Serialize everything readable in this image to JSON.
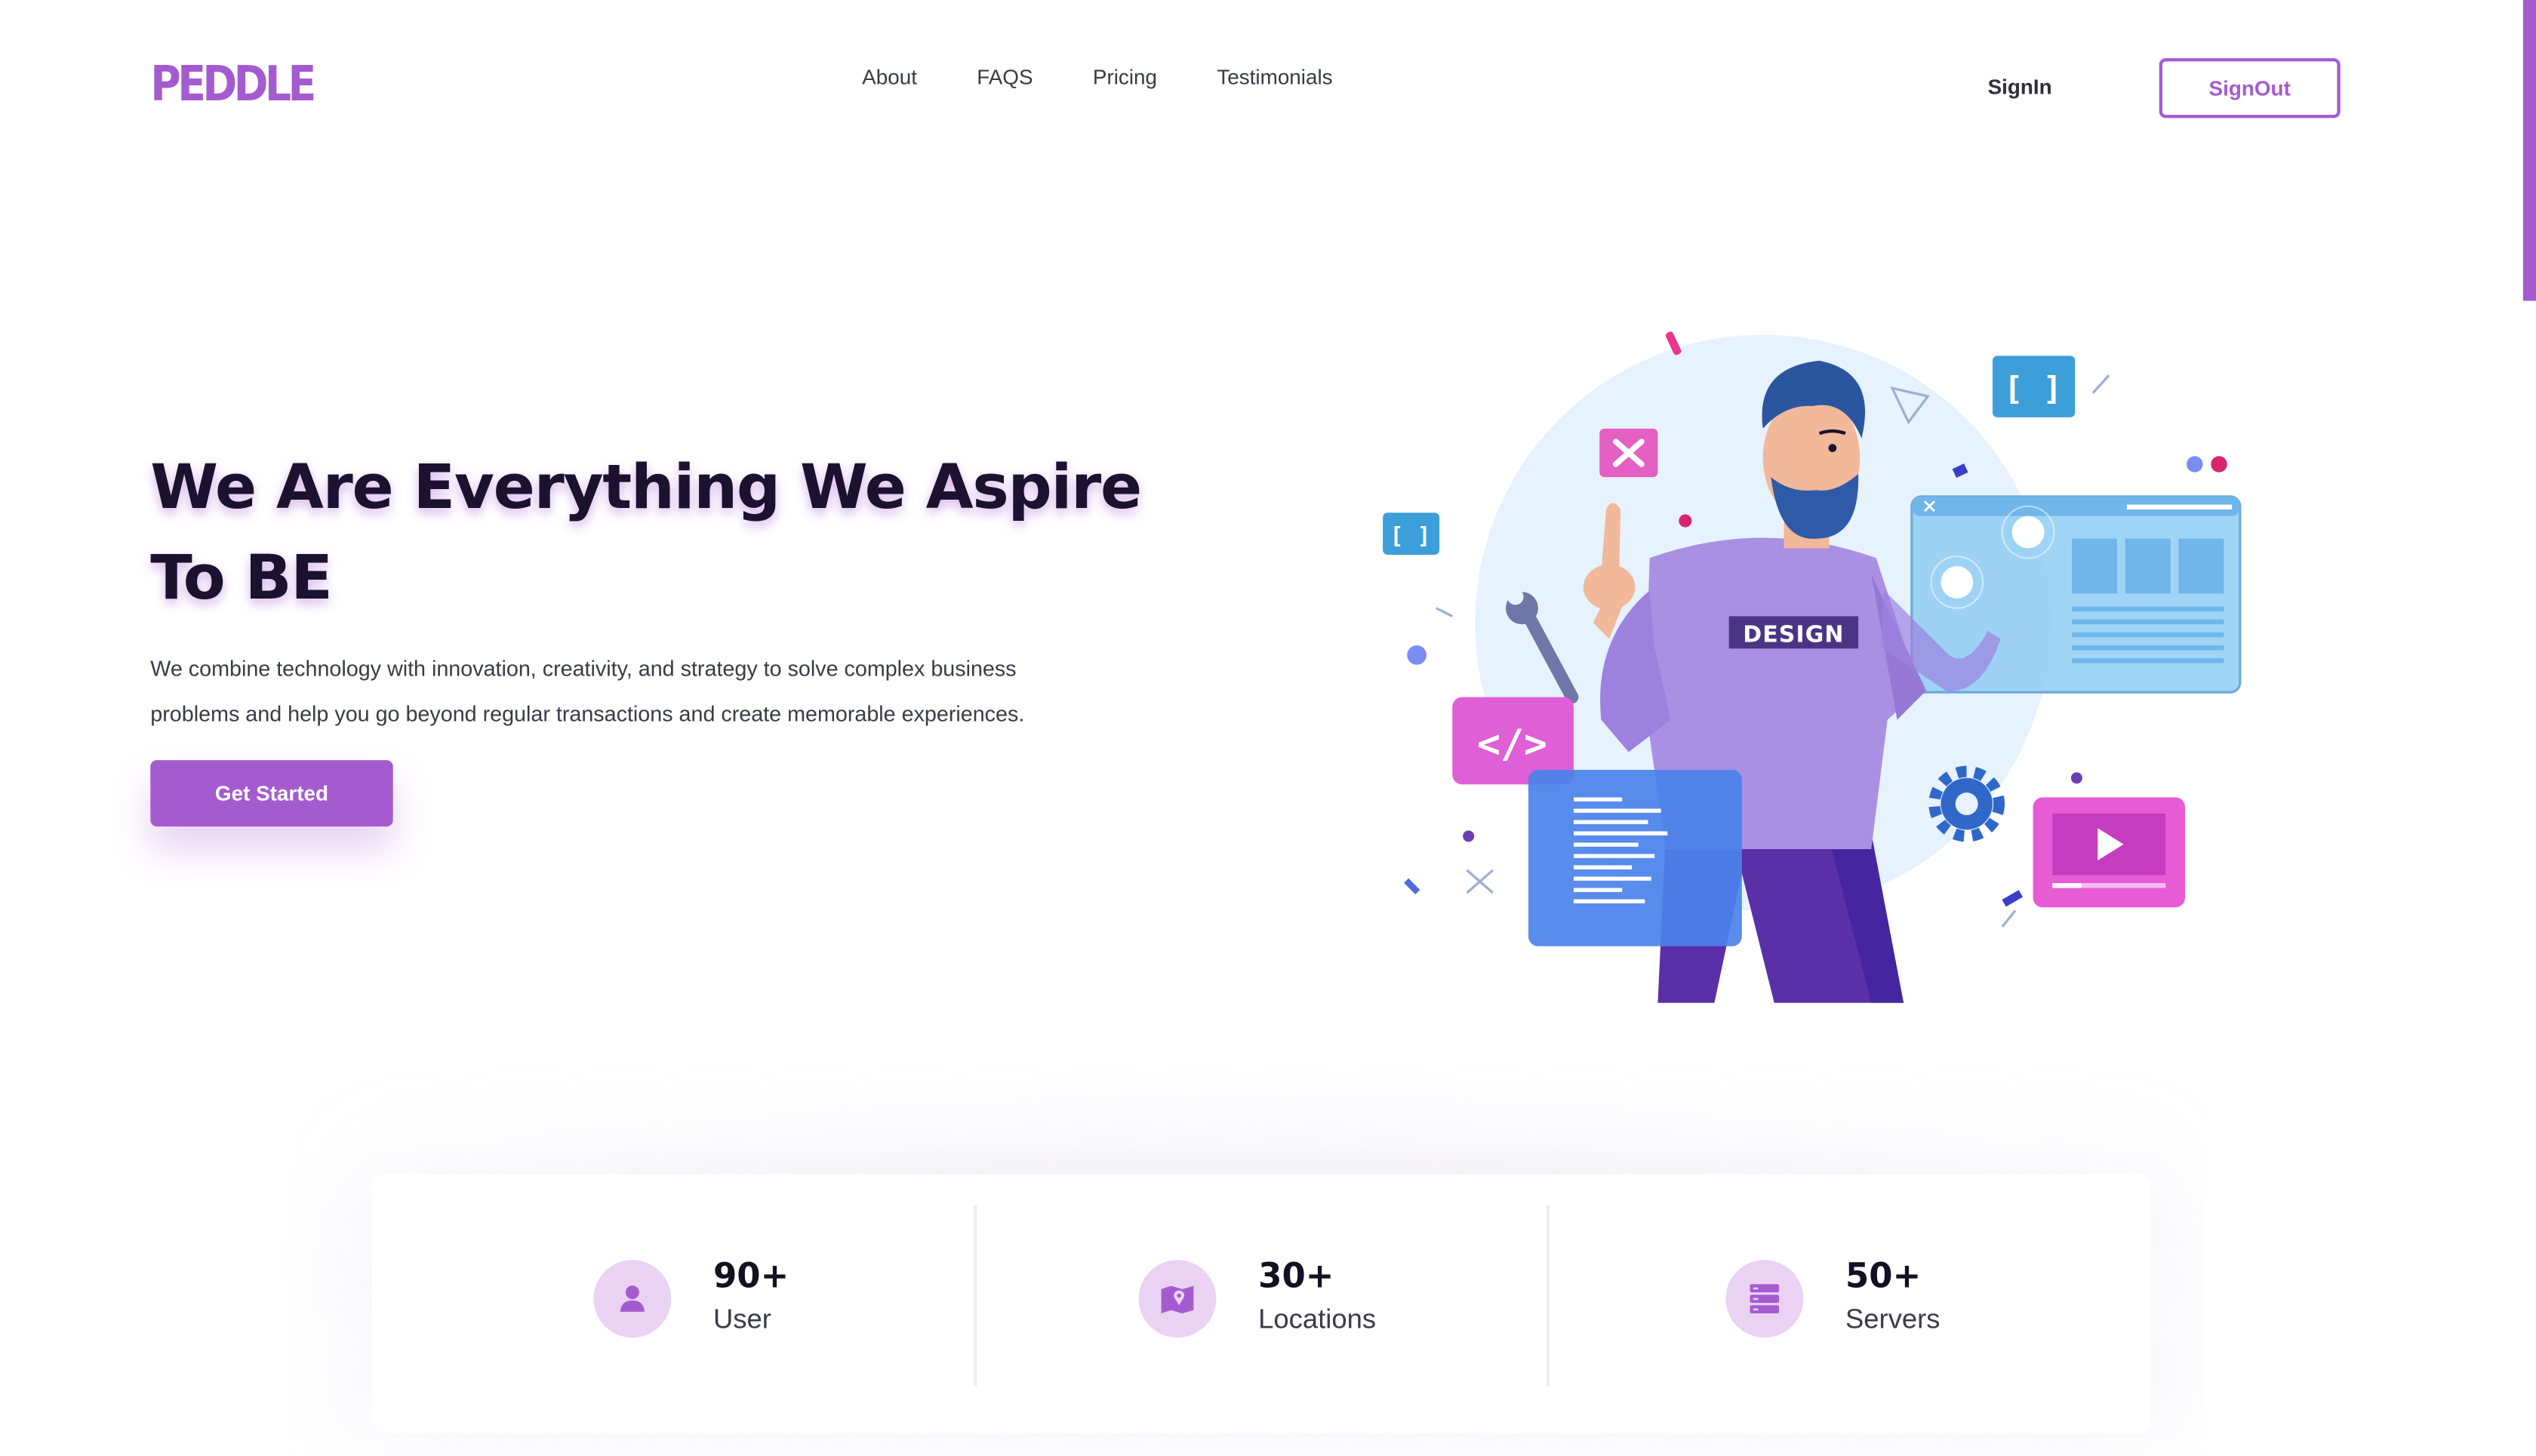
{
  "brand": {
    "logo_text": "PEDDLE",
    "accent_color": "#a55bd0"
  },
  "nav": {
    "links": [
      "About",
      "FAQS",
      "Pricing",
      "Testimonials"
    ],
    "signin_label": "SignIn",
    "signout_label": "SignOut"
  },
  "hero": {
    "title_line1": "We Are Everything We Aspire",
    "title_line2": "To BE",
    "description_line1": "We combine technology with innovation, creativity, and strategy to solve complex business",
    "description_line2": "problems and help you go beyond regular transactions and create memorable experiences.",
    "cta_label": "Get Started",
    "illustration": {
      "shirt_label": "DESIGN"
    }
  },
  "stats": [
    {
      "icon": "user-icon",
      "value": "90+",
      "label": "User"
    },
    {
      "icon": "map-icon",
      "value": "30+",
      "label": "Locations"
    },
    {
      "icon": "server-icon",
      "value": "50+",
      "label": "Servers"
    }
  ]
}
